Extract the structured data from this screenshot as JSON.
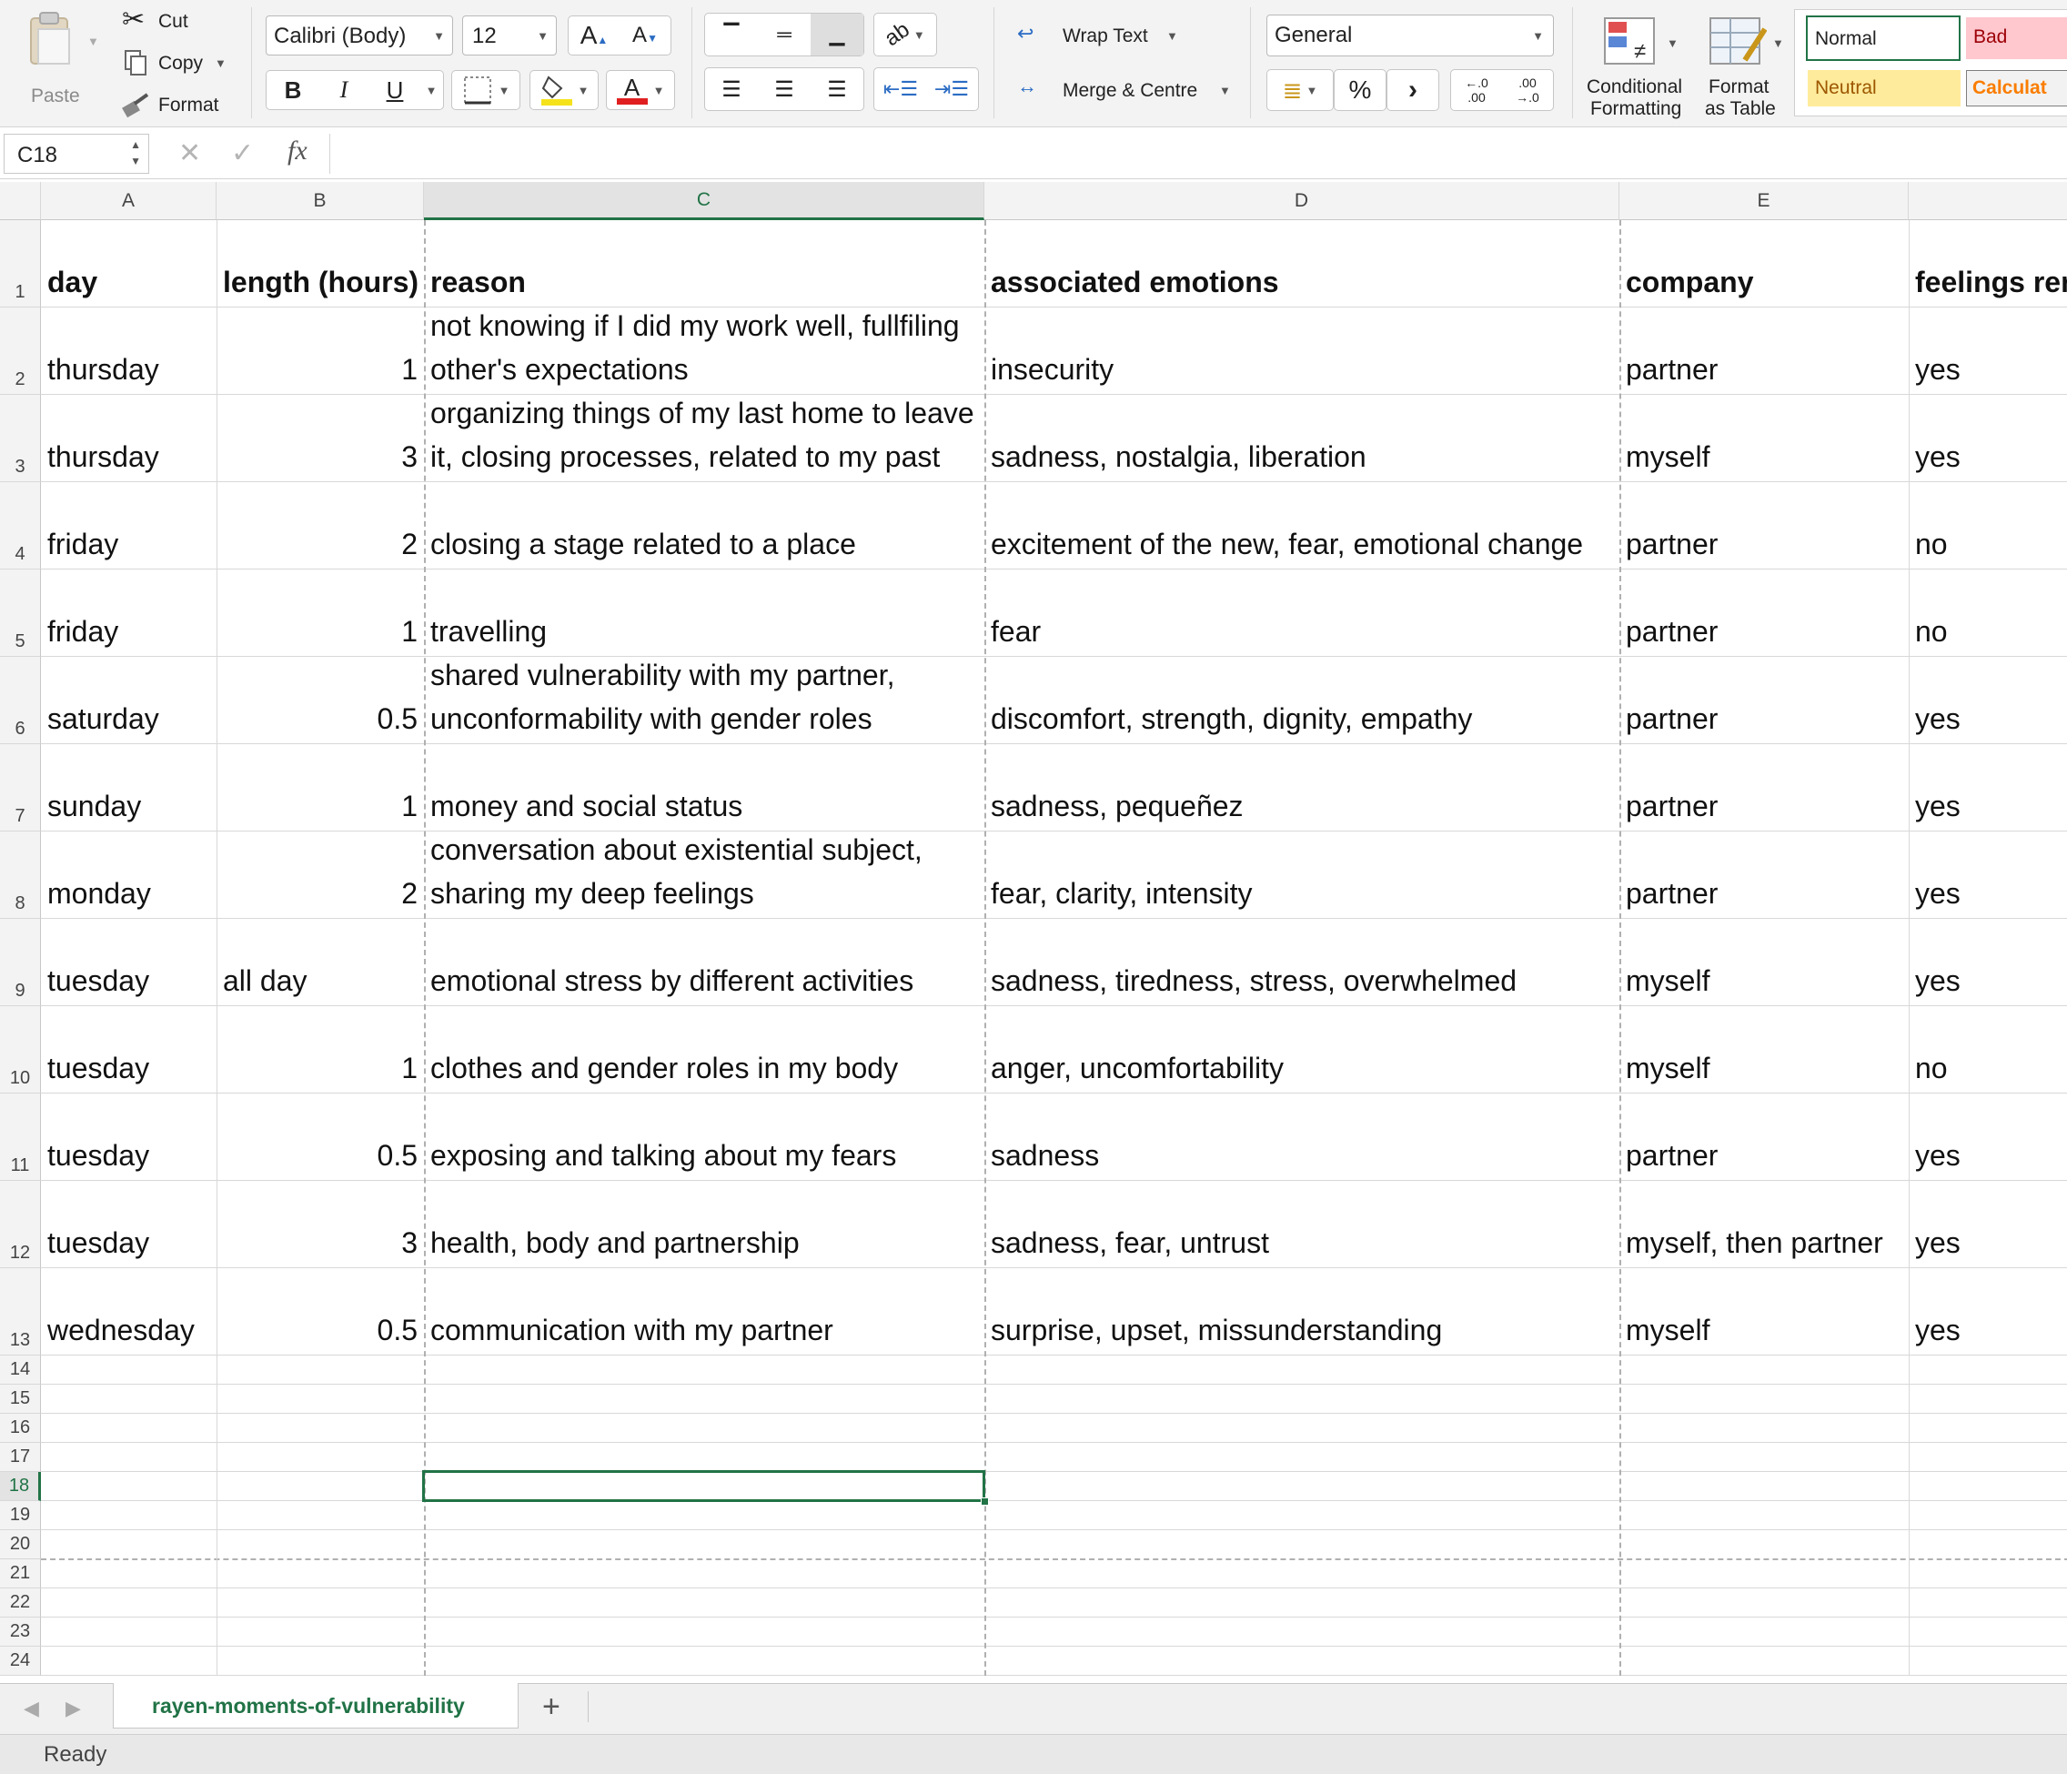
{
  "ribbon": {
    "paste": "Paste",
    "cut": "Cut",
    "copy": "Copy",
    "format": "Format",
    "font_name": "Calibri (Body)",
    "font_size": "12",
    "grow_font": "A",
    "shrink_font": "A",
    "bold": "B",
    "italic": "I",
    "underline": "U",
    "font_color_glyph": "A",
    "wrap_text": "Wrap Text",
    "merge_centre": "Merge & Centre",
    "number_format": "General",
    "percent": "%",
    "comma": "›",
    "inc_decimal_top": "←.0",
    "inc_decimal_bot": ".00",
    "dec_decimal_top": ".00",
    "dec_decimal_bot": "→.0",
    "conditional_line1": "Conditional",
    "conditional_line2": "Formatting",
    "format_table_line1": "Format",
    "format_table_line2": "as Table",
    "styles": {
      "normal": "Normal",
      "bad": "Bad",
      "neutral": "Neutral",
      "calculation": "Calculat"
    }
  },
  "formula_bar": {
    "name_box": "C18",
    "cancel": "✕",
    "enter": "✓",
    "fx": "fx",
    "formula": ""
  },
  "columns": [
    "A",
    "B",
    "C",
    "D",
    "E",
    ""
  ],
  "header_row": [
    "day",
    "length (hours)",
    "reason",
    "associated emotions",
    "company",
    "feelings rer"
  ],
  "rows": [
    {
      "n": "2",
      "day": "thursday",
      "length": "1",
      "reason": [
        "not knowing if I did my work well, fullfiling",
        "other's expectations"
      ],
      "emotions": "insecurity",
      "company": "partner",
      "feelings": "yes"
    },
    {
      "n": "3",
      "day": "thursday",
      "length": "3",
      "reason": [
        "organizing things of my last home to leave",
        "it, closing processes, related to my past"
      ],
      "emotions": "sadness, nostalgia, liberation",
      "company": "myself",
      "feelings": "yes"
    },
    {
      "n": "4",
      "day": "friday",
      "length": "2",
      "reason": [
        "closing a stage related to a place"
      ],
      "emotions": "excitement of the new, fear, emotional change",
      "company": "partner",
      "feelings": "no"
    },
    {
      "n": "5",
      "day": "friday",
      "length": "1",
      "reason": [
        "travelling"
      ],
      "emotions": "fear",
      "company": "partner",
      "feelings": "no"
    },
    {
      "n": "6",
      "day": "saturday",
      "length": "0.5",
      "reason": [
        "shared vulnerability with my partner,",
        "unconformability with gender roles"
      ],
      "emotions": "discomfort, strength, dignity, empathy",
      "company": "partner",
      "feelings": "yes"
    },
    {
      "n": "7",
      "day": "sunday",
      "length": "1",
      "reason": [
        "money and social status"
      ],
      "emotions": "sadness, pequeñez",
      "company": "partner",
      "feelings": "yes"
    },
    {
      "n": "8",
      "day": "monday",
      "length": "2",
      "reason": [
        "conversation about existential subject,",
        "sharing my deep feelings"
      ],
      "emotions": "fear, clarity, intensity",
      "company": "partner",
      "feelings": "yes"
    },
    {
      "n": "9",
      "day": "tuesday",
      "length": "all day",
      "length_text": true,
      "reason": [
        "emotional stress by different activities"
      ],
      "emotions": "sadness, tiredness, stress, overwhelmed",
      "company": "myself",
      "feelings": "yes"
    },
    {
      "n": "10",
      "day": "tuesday",
      "length": "1",
      "reason": [
        "clothes and gender roles in my body"
      ],
      "emotions": "anger, uncomfortability",
      "company": "myself",
      "feelings": "no"
    },
    {
      "n": "11",
      "day": "tuesday",
      "length": "0.5",
      "reason": [
        "exposing and talking about my fears"
      ],
      "emotions": "sadness",
      "company": "partner",
      "feelings": "yes"
    },
    {
      "n": "12",
      "day": "tuesday",
      "length": "3",
      "reason": [
        "health, body and partnership"
      ],
      "emotions": "sadness, fear, untrust",
      "company": "myself, then partner",
      "feelings": "yes"
    },
    {
      "n": "13",
      "day": "wednesday",
      "length": "0.5",
      "reason": [
        "communication with my partner"
      ],
      "emotions": "surprise, upset, missunderstanding",
      "company": "myself",
      "feelings": "yes"
    }
  ],
  "empty_rows": [
    "14",
    "15",
    "16",
    "17",
    "18",
    "19",
    "20",
    "21",
    "22",
    "23",
    "24"
  ],
  "sheet_tab": "rayen-moments-of-vulnerability",
  "add_sheet": "+",
  "status": "Ready",
  "colors": {
    "accent_green": "#217346",
    "font_red": "#e02020",
    "fill_yellow": "#f5e21b"
  }
}
